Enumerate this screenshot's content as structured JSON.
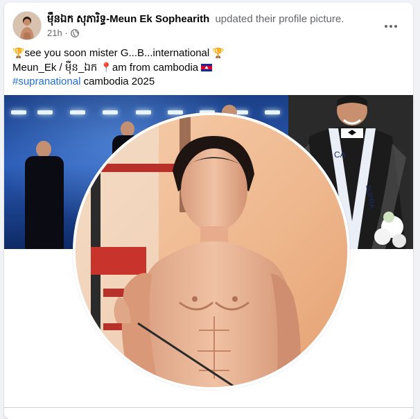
{
  "post": {
    "author": "ម៉ឺនឯក សុភារិទ្ធ-Meun Ek Sophearith",
    "action": "updated their profile picture.",
    "time": "21h",
    "separator": "·",
    "privacy_icon": "globe-icon",
    "more_icon": "more-options-icon",
    "lines": {
      "line1_text": "see you soon  mister G...B...international ",
      "line1_emoji_start": "🏆",
      "line1_emoji_end": "🏆",
      "line2_text_a": "Meun_Ek / ម៉ឺន_ឯក ",
      "line2_pin": "📍",
      "line2_text_b": "am from cambodia ",
      "line2_flag_icon": "cambodia-flag-icon",
      "line3_hashtag": "#supranational",
      "line3_text": " cambodia 2025"
    }
  },
  "colors": {
    "hashtag": "#216fdb",
    "meta": "#65676b",
    "text": "#050505",
    "card": "#ffffff",
    "page_bg": "#f0f2f5"
  },
  "media": {
    "cover_icon": "cover-photo",
    "profile_icon": "profile-photo"
  }
}
